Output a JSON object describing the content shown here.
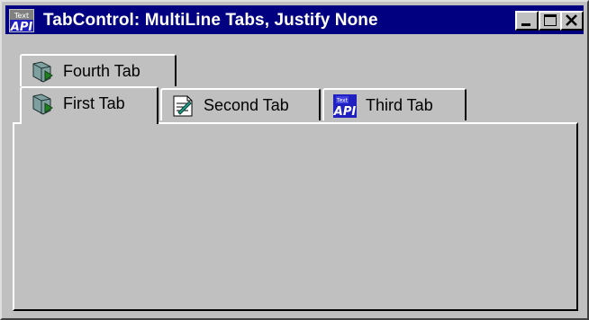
{
  "window": {
    "title": "TabControl: MultiLine Tabs, Justify None",
    "icon": "api-icon",
    "controls": [
      "minimize-icon",
      "maximize-icon",
      "close-icon"
    ]
  },
  "tabs": {
    "row_back": [
      {
        "label": "Fourth Tab",
        "icon": "fourth-tab-icon"
      }
    ],
    "row_front": [
      {
        "label": "First Tab",
        "icon": "first-tab-icon",
        "selected": true
      },
      {
        "label": "Second Tab",
        "icon": "document-icon"
      },
      {
        "label": "Third Tab",
        "icon": "api-icon"
      }
    ]
  },
  "colors": {
    "titlebar": "#000080",
    "face": "#c0c0c0"
  }
}
